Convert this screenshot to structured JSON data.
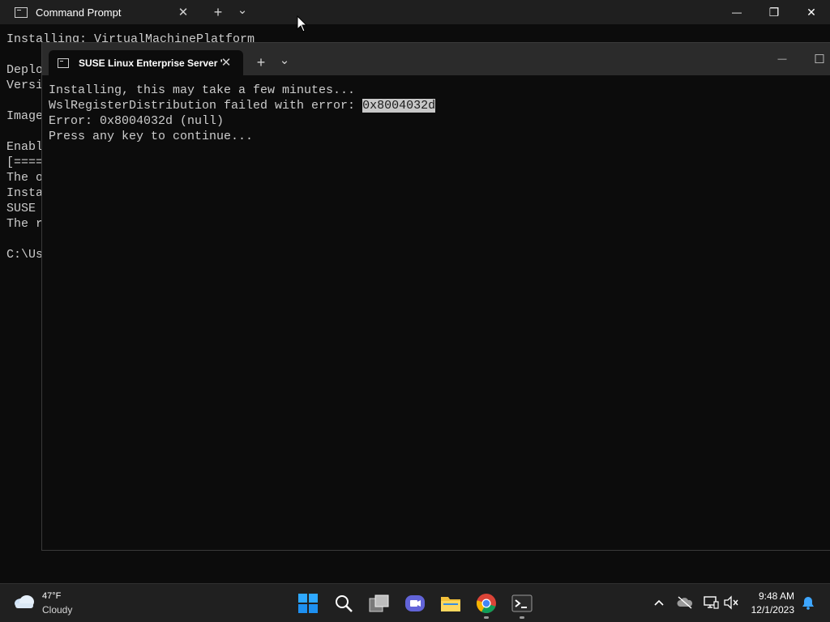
{
  "back_window": {
    "tab_title": "Command Prompt",
    "close_glyph": "✕",
    "new_tab_glyph": "+",
    "dropdown_glyph": "⌄",
    "minimize_glyph": "—",
    "restore_glyph": "❐",
    "window_close_glyph": "✕",
    "lines_top": "Installing: VirtualMachinePlatform",
    "lines_left": [
      "",
      "Deplo",
      "Versi",
      "",
      "Image",
      "",
      "Enabl",
      "[====",
      "The o",
      "Insta",
      "SUSE ",
      "The r",
      "",
      "C:\\Us"
    ]
  },
  "front_window": {
    "tab_title": "SUSE Linux Enterprise Server '",
    "close_glyph": "✕",
    "new_tab_glyph": "+",
    "dropdown_glyph": "⌄",
    "minimize_glyph": "—",
    "maximize_glyph": "☐",
    "line1": "Installing, this may take a few minutes...",
    "line2_prefix": "WslRegisterDistribution failed with error: ",
    "line2_code": "0x8004032d",
    "line3": "Error: 0x8004032d (null)",
    "line4": "Press any key to continue..."
  },
  "taskbar": {
    "weather_temp": "47°F",
    "weather_desc": "Cloudy",
    "clock_time": "9:48 AM",
    "clock_date": "12/1/2023",
    "tray_chevron": "^",
    "icons": [
      "windows-start-icon",
      "search-icon",
      "task-view-icon",
      "chat-icon",
      "file-explorer-icon",
      "chrome-icon",
      "terminal-icon"
    ]
  },
  "colors": {
    "terminal_bg": "#0c0c0c",
    "text": "#cccccc",
    "selection": "#c8c8c8",
    "taskbar": "#202020"
  }
}
